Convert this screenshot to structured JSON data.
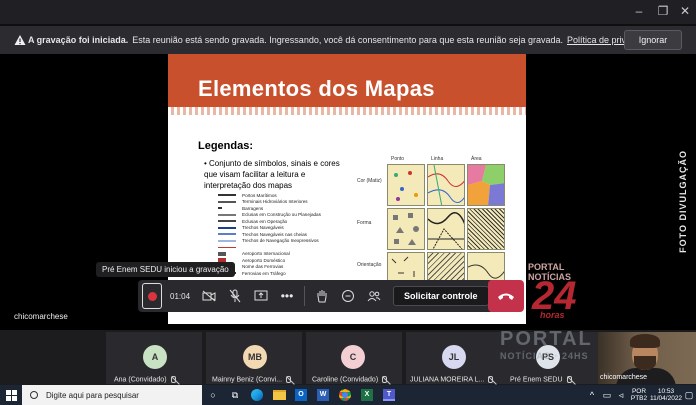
{
  "window": {
    "minimize": "–",
    "restore": "❐",
    "close": "✕"
  },
  "banner": {
    "bold": "A gravação foi iniciada.",
    "text": "Esta reunião está sendo gravada. Ingressando, você dá consentimento para que esta reunião seja gravada.",
    "link": "Política de privacidade",
    "ignore": "Ignorar"
  },
  "slide": {
    "title": "Elementos dos Mapas",
    "legend_title": "Legendas:",
    "legend_text": "• Conjunto de símbolos, sinais e cores que visam facilitar a leitura e interpretação dos mapas",
    "legend_items": [
      "Portos Marítimos",
      "Terminais Hidroviários Interiores",
      "Barragens",
      "Eclusas em Construção ou Planejadas",
      "Eclusas em Operação",
      "Trechos Navegáveis",
      "Trechos Navegáveis nas cheias",
      "Trechos de Navegação Inexpressivos",
      "",
      "Aeroporto Internacional",
      "Aeroporto Doméstico",
      "Nome das Ferrovias",
      "Ferrovias em Tráfego"
    ],
    "map_cols": [
      "Ponto",
      "Linha",
      "Área"
    ],
    "map_rows": [
      "Cor (Matiz)",
      "Forma",
      "Orientação"
    ]
  },
  "watermark": "FOTO DIVULGAÇÃO",
  "stage_name": "chicomarchese",
  "tooltip": "Pré Enem SEDU iniciou a gravação",
  "toolbar": {
    "timer": "01:04",
    "request": "Solicitar controle"
  },
  "portal_logo": {
    "l1": "PORTAL",
    "l2": "NOTÍCIAS",
    "num": "24",
    "l4": "horas"
  },
  "participants": [
    {
      "initials": "A",
      "name": "Ana (Convidado)",
      "color": "#c9e2c3"
    },
    {
      "initials": "MB",
      "name": "Mainny Beniz (Convi...",
      "color": "#f2d9b3"
    },
    {
      "initials": "C",
      "name": "Caroline (Convidado)",
      "color": "#f3cfd3"
    },
    {
      "initials": "JL",
      "name": "JULIANA MOREIRA L...",
      "color": "#d6d9ef"
    },
    {
      "initials": "PS",
      "name": "Pré Enem SEDU",
      "color": "#dfe3ea"
    }
  ],
  "self_name": "chicomarchese",
  "portal_wm": {
    "l1": "PORTAL",
    "l2": "NOTÍCIAS · 24HS"
  },
  "taskbar": {
    "search_placeholder": "Digite aqui para pesquisar",
    "lang1": "POR",
    "lang2": "PTB2",
    "time": "10:53",
    "date": "11/04/2022"
  }
}
